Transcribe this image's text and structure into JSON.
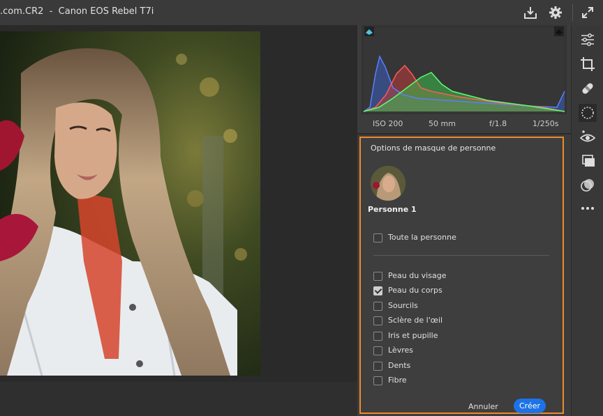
{
  "titlebar": {
    "filename": ".com.CR2",
    "separator": "-",
    "camera": "Canon EOS Rebel T7i"
  },
  "histogram": {
    "iso": "ISO 200",
    "focal": "50 mm",
    "aperture": "f/1.8",
    "shutter": "1/250s"
  },
  "mask_panel": {
    "title": "Options de masque de personne",
    "person_name": "Personne 1",
    "whole_person": {
      "label": "Toute la personne",
      "checked": false
    },
    "options": [
      {
        "label": "Peau du visage",
        "checked": false
      },
      {
        "label": "Peau du corps",
        "checked": true
      },
      {
        "label": "Sourcils",
        "checked": false
      },
      {
        "label": "Sclère de l'œil",
        "checked": false
      },
      {
        "label": "Iris et pupille",
        "checked": false
      },
      {
        "label": "Lèvres",
        "checked": false
      },
      {
        "label": "Dents",
        "checked": false
      },
      {
        "label": "Fibre",
        "checked": false
      }
    ],
    "cancel_label": "Annuler",
    "create_label": "Créer"
  },
  "colors": {
    "accent_border": "#ef8a2c",
    "primary_button": "#1c73e8"
  },
  "toolstrip": [
    "edit-sliders-icon",
    "crop-icon",
    "heal-icon",
    "masking-icon",
    "red-eye-icon",
    "presets-icon",
    "snapshots-icon",
    "more-icon"
  ]
}
